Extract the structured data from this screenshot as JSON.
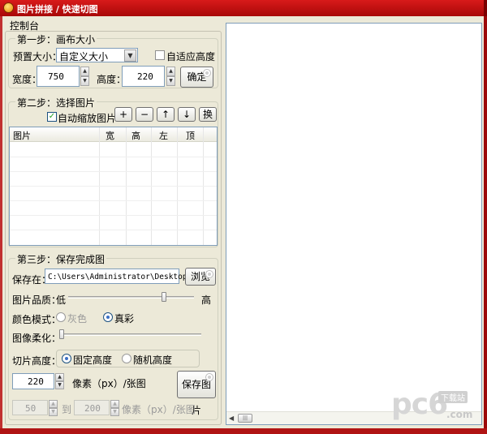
{
  "window": {
    "title": "图片拼接 / 快速切图"
  },
  "console": {
    "label": "控制台"
  },
  "step1": {
    "title": "第一步：画布大小",
    "preset_label": "预置大小：",
    "preset_value": "自定义大小",
    "auto_height_label": "自适应高度",
    "width_label": "宽度：",
    "width_value": "750",
    "height_label": "高度：",
    "height_value": "220",
    "confirm_button": "确定"
  },
  "step2": {
    "title": "第二步：选择图片",
    "auto_scale_label": "自动缩放图片",
    "buttons": {
      "add": "+",
      "remove": "−",
      "up": "↑",
      "down": "↓",
      "swap": "换"
    },
    "columns": [
      "图片",
      "宽",
      "高",
      "左",
      "顶"
    ]
  },
  "step3": {
    "title": "第三步：保存完成图",
    "save_to_label": "保存在：",
    "save_path": "C:\\Users\\Administrator\\Desktop",
    "browse_button": "浏览",
    "quality_label": "图片品质：",
    "quality_low": "低",
    "quality_high": "高",
    "quality_level": 0.77,
    "color_mode_label": "颜色模式：",
    "color_gray": "灰色",
    "color_true": "真彩",
    "soften_label": "图像柔化：",
    "soften_level": 0.0,
    "slice_height_label": "切片高度：",
    "slice_fixed": "固定高度",
    "slice_random": "随机高度",
    "fixed_value": "220",
    "fixed_unit": "像素（px）/张图",
    "save_button": "保存图片",
    "random_min": "50",
    "random_to": "到",
    "random_max": "200",
    "random_unit": "像素（px）/张图"
  },
  "watermark": {
    "logo": "pc6",
    "tag": "下载站",
    "domain": ".com"
  },
  "colors": {
    "titlebar": "#c81010",
    "panel_bg": "#ece9d8",
    "accent": "#3b6fc4"
  }
}
